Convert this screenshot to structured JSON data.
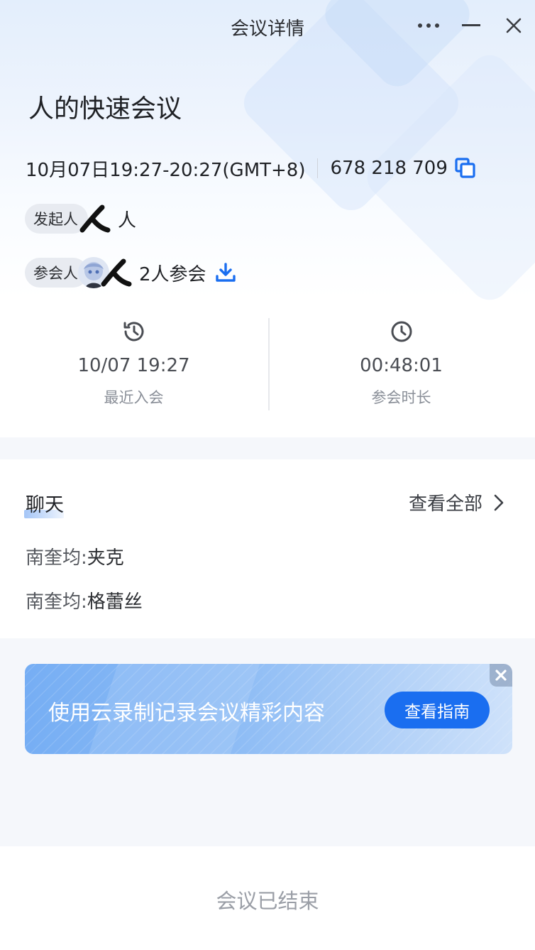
{
  "window": {
    "title": "会议详情"
  },
  "meeting": {
    "title": "人的快速会议",
    "time": "10月07日19:27-20:27(GMT+8)",
    "meeting_id": "678 218 709"
  },
  "host": {
    "chip_label": "发起人",
    "name": "人"
  },
  "attendees": {
    "chip_label": "参会人",
    "summary": "2人参会"
  },
  "stats": {
    "last_join": {
      "value": "10/07 19:27",
      "label": "最近入会"
    },
    "duration": {
      "value": "00:48:01",
      "label": "参会时长"
    }
  },
  "chat": {
    "title": "聊天",
    "view_all": "查看全部",
    "messages": [
      {
        "sender": "南奎均:",
        "text": "夹克"
      },
      {
        "sender": "南奎均:",
        "text": "格蕾丝"
      }
    ]
  },
  "banner": {
    "text": "使用云录制记录会议精彩内容",
    "button": "查看指南"
  },
  "footer": {
    "status": "会议已结束"
  },
  "colors": {
    "accent": "#1a6ef0",
    "icon_gray": "#4a4d53",
    "muted_text": "#8a8f98"
  }
}
